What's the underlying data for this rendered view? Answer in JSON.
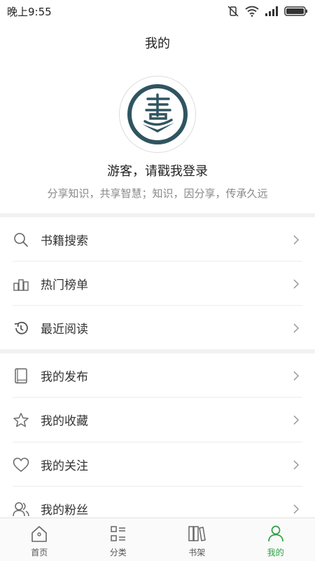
{
  "status": {
    "time": "晚上9:55"
  },
  "header": {
    "title": "我的"
  },
  "profile": {
    "name": "游客，请戳我登录",
    "slogan": "分享知识，共享智慧；知识，因分享，传承久远"
  },
  "menu_group1": [
    {
      "label": "书籍搜索",
      "icon": "search-icon"
    },
    {
      "label": "热门榜单",
      "icon": "ranking-icon"
    },
    {
      "label": "最近阅读",
      "icon": "history-icon"
    }
  ],
  "menu_group2": [
    {
      "label": "我的发布",
      "icon": "book-icon"
    },
    {
      "label": "我的收藏",
      "icon": "star-icon"
    },
    {
      "label": "我的关注",
      "icon": "heart-icon"
    },
    {
      "label": "我的粉丝",
      "icon": "fans-icon"
    }
  ],
  "tabs": [
    {
      "label": "首页",
      "icon": "home-icon"
    },
    {
      "label": "分类",
      "icon": "category-icon"
    },
    {
      "label": "书架",
      "icon": "bookshelf-icon"
    },
    {
      "label": "我的",
      "icon": "user-icon",
      "active": true
    }
  ],
  "colors": {
    "accent": "#2ea043",
    "logo": "#2f5560"
  }
}
